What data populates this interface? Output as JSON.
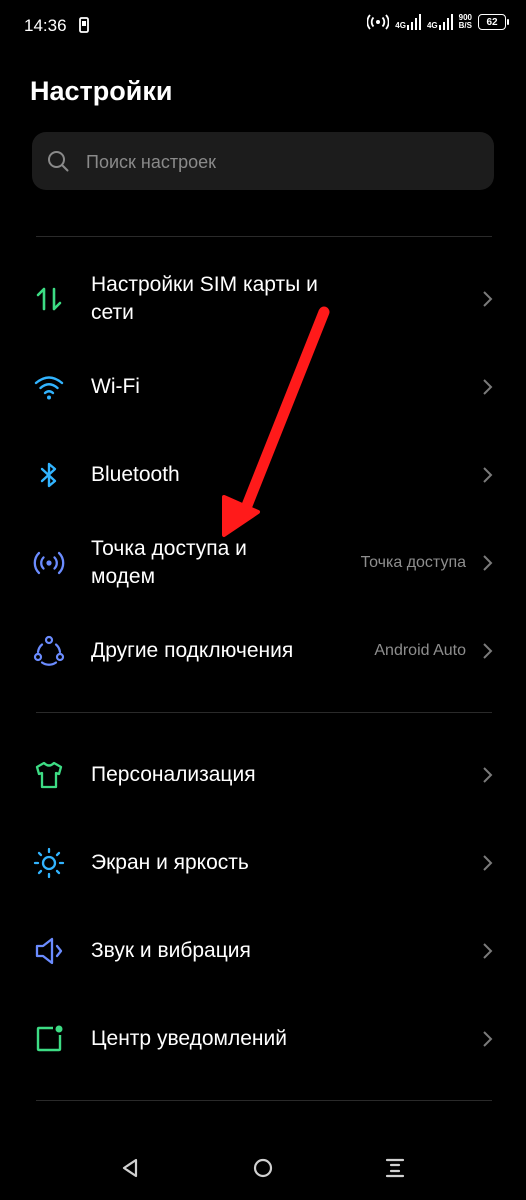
{
  "status_bar": {
    "time": "14:36",
    "network1": "4G",
    "network2": "4G",
    "speed_value": "900",
    "speed_unit": "B/S",
    "battery": "62"
  },
  "page_title": "Настройки",
  "search": {
    "placeholder": "Поиск настроек"
  },
  "sections": [
    {
      "items": [
        {
          "label": "Настройки SIM карты и сети",
          "value": "",
          "icon": "sim-network-icon",
          "color": "#3ddc84"
        },
        {
          "label": "Wi-Fi",
          "value": "",
          "icon": "wifi-icon",
          "color": "#32b4ff"
        },
        {
          "label": "Bluetooth",
          "value": "",
          "icon": "bluetooth-icon",
          "color": "#32b4ff"
        },
        {
          "label": "Точка доступа и модем",
          "value": "Точка доступа",
          "icon": "hotspot-icon",
          "color": "#6b8cff"
        },
        {
          "label": "Другие подключения",
          "value": "Android Auto",
          "icon": "connections-icon",
          "color": "#6b8cff"
        }
      ]
    },
    {
      "items": [
        {
          "label": "Персонализация",
          "value": "",
          "icon": "tshirt-icon",
          "color": "#3ddc84"
        },
        {
          "label": "Экран и яркость",
          "value": "",
          "icon": "brightness-icon",
          "color": "#32b4ff"
        },
        {
          "label": "Звук и вибрация",
          "value": "",
          "icon": "speaker-icon",
          "color": "#6b8cff"
        },
        {
          "label": "Центр уведомлений",
          "value": "",
          "icon": "notification-icon",
          "color": "#3ddc84"
        }
      ]
    }
  ],
  "annotation": {
    "arrow_color": "#ff1a1a"
  },
  "navigation": {
    "back": "back-icon",
    "home": "home-icon",
    "menu": "menu-icon"
  }
}
